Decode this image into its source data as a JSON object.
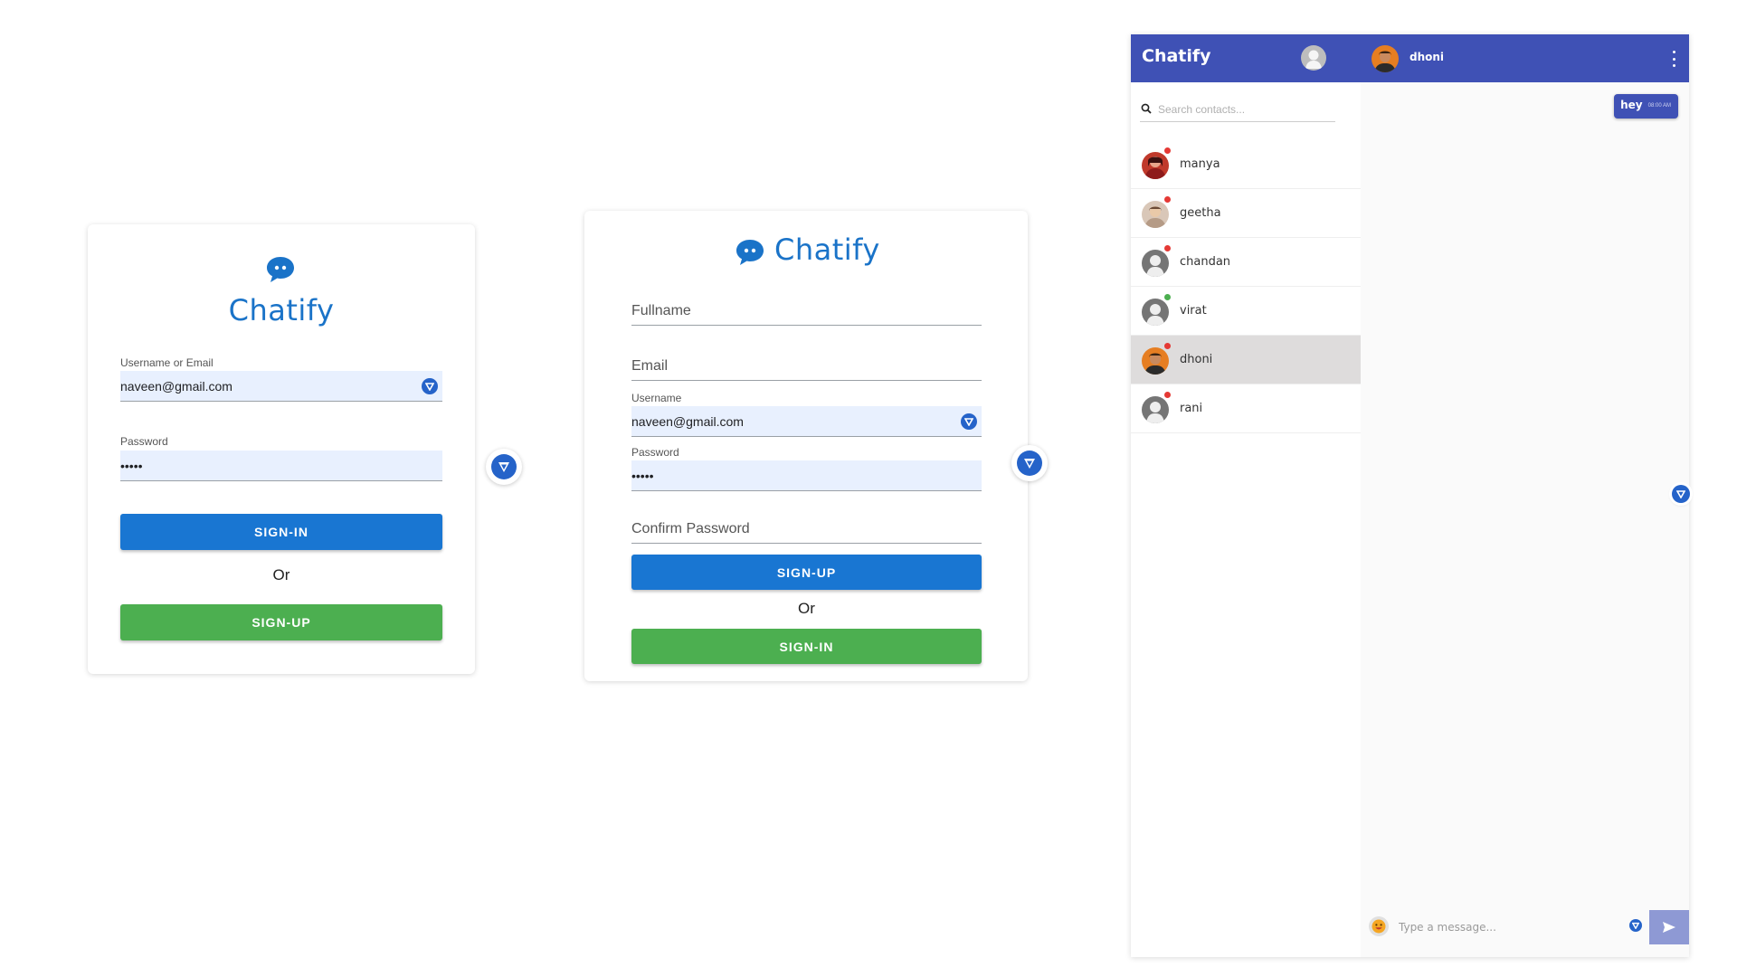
{
  "brand": "Chatify",
  "colors": {
    "brand_blue": "#1a73c8",
    "primary_button": "#1976d2",
    "secondary_button": "#4caf50",
    "chat_header": "#3f51b5",
    "active_contact": "#dedcdc",
    "online": "#4caf50",
    "offline": "#e53935"
  },
  "signin": {
    "title": "Chatify",
    "username_label": "Username or Email",
    "username_value": "naveen@gmail.com",
    "password_label": "Password",
    "password_value": "•••••",
    "signin_button": "SIGN-IN",
    "or_text": "Or",
    "signup_button": "SIGN-UP"
  },
  "signup": {
    "title": "Chatify",
    "fullname_placeholder": "Fullname",
    "email_placeholder": "Email",
    "username_label": "Username",
    "username_value": "naveen@gmail.com",
    "password_label": "Password",
    "password_value": "•••••",
    "confirm_password_placeholder": "Confirm Password",
    "signup_button": "SIGN-UP",
    "or_text": "Or",
    "signin_button": "SIGN-IN"
  },
  "chat": {
    "app_title": "Chatify",
    "search_placeholder": "Search contacts...",
    "contacts": [
      {
        "name": "manya",
        "status": "offline",
        "avatar": "photo-red"
      },
      {
        "name": "geetha",
        "status": "offline",
        "avatar": "photo-beige"
      },
      {
        "name": "chandan",
        "status": "offline",
        "avatar": "default-user"
      },
      {
        "name": "virat",
        "status": "online",
        "avatar": "default-user"
      },
      {
        "name": "dhoni",
        "status": "offline",
        "avatar": "photo-orange",
        "active": true
      },
      {
        "name": "rani",
        "status": "offline",
        "avatar": "default-user"
      }
    ],
    "active_contact": "dhoni",
    "messages": [
      {
        "text": "hey",
        "time": "08:00 AM",
        "from_me": true
      }
    ],
    "composer_placeholder": "Type a message...",
    "icons": {
      "search": "search-icon",
      "more": "kebab-menu-icon",
      "emoji": "emoji-icon",
      "send": "send-icon"
    }
  }
}
